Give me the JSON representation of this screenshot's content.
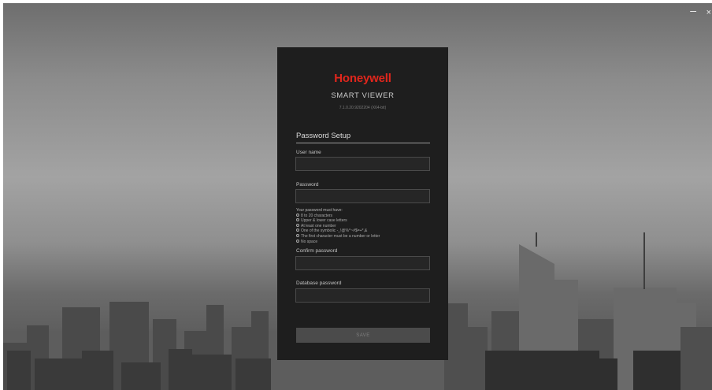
{
  "window": {
    "minimize_glyph": "–",
    "close_glyph": "×"
  },
  "app": {
    "brand": "Honeywell",
    "name": "SMART VIEWER",
    "version": "7.1.0.20.9202204 (X64-bit)"
  },
  "form": {
    "title": "Password Setup",
    "username_label": "User name",
    "username_value": "",
    "password_label": "Password",
    "password_value": "",
    "rules_heading": "Your password must have:",
    "rules": [
      "8 to 20 characters",
      "Upper & lower case letters",
      "At least one number",
      "One of the symbolic -_!@%^~#$=+*,&",
      "The first character must be a number or letter",
      "No space"
    ],
    "confirm_label": "Confirm password",
    "confirm_value": "",
    "db_password_label": "Database password",
    "db_password_value": "",
    "save_label": "SAVE"
  },
  "colors": {
    "brand_red": "#e1261c",
    "panel_bg": "#1e1e1e",
    "button_bg": "#4b4b4b"
  }
}
